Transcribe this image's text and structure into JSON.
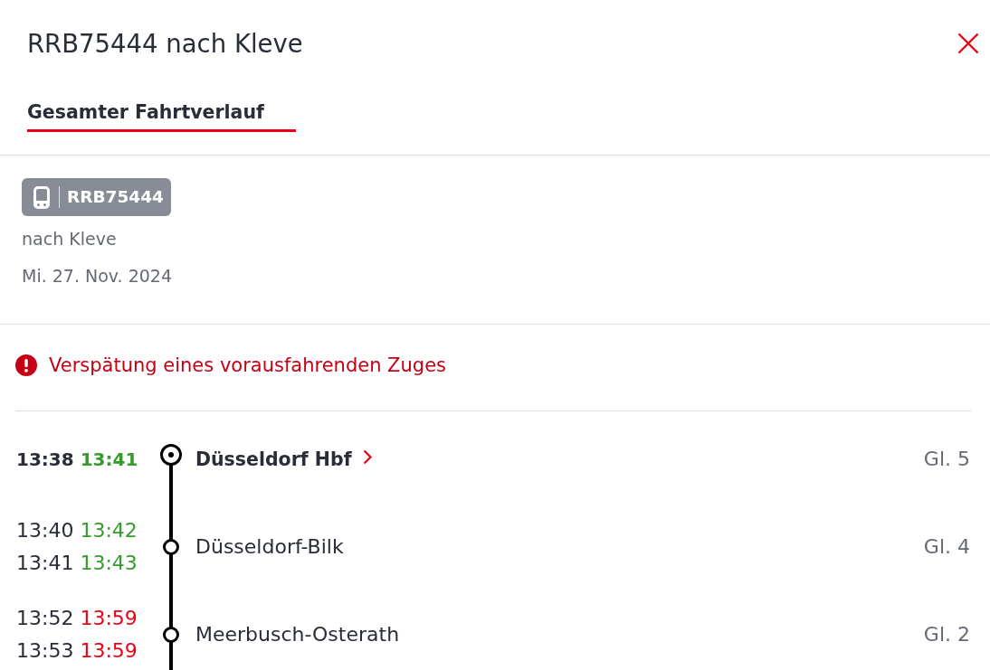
{
  "header": {
    "title": "RRB75444 nach Kleve"
  },
  "tabs": [
    {
      "label": "Gesamter Fahrtverlauf",
      "selected": true
    }
  ],
  "train": {
    "number": "RRB75444",
    "direction": "nach Kleve",
    "date": "Mi. 27. Nov. 2024"
  },
  "notice": {
    "text": "Verspätung eines vorausfahrenden Zuges"
  },
  "stops": [
    {
      "kind": "origin",
      "name": "Düsseldorf Hbf",
      "platform": "Gl. 5",
      "times": [
        {
          "planned": "13:38",
          "actual": "13:41",
          "late": false
        }
      ]
    },
    {
      "kind": "stop",
      "name": "Düsseldorf-Bilk",
      "platform": "Gl. 4",
      "times": [
        {
          "planned": "13:40",
          "actual": "13:42",
          "late": false
        },
        {
          "planned": "13:41",
          "actual": "13:43",
          "late": false
        }
      ]
    },
    {
      "kind": "stop",
      "name": "Meerbusch-Osterath",
      "platform": "Gl. 2",
      "times": [
        {
          "planned": "13:52",
          "actual": "13:59",
          "late": true
        },
        {
          "planned": "13:53",
          "actual": "13:59",
          "late": true
        }
      ]
    }
  ]
}
